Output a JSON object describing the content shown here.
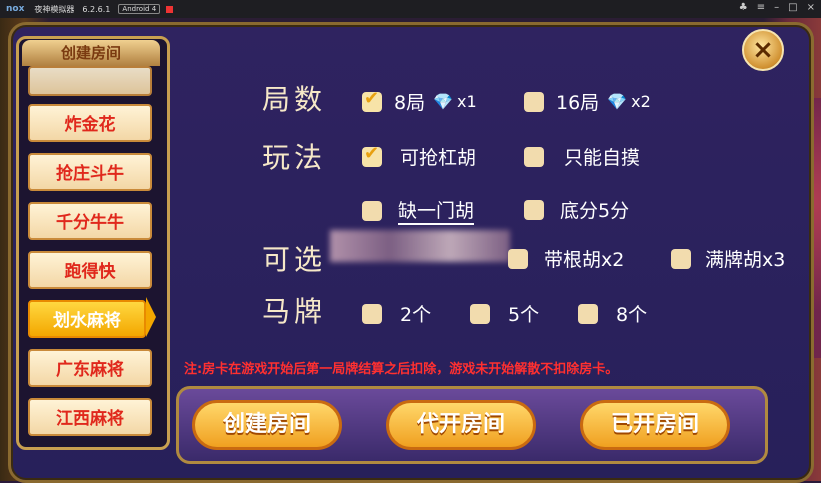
{
  "emulator": {
    "logo": "nox",
    "app_name": "夜神模拟器",
    "version": "6.2.6.1",
    "os": "Android 4"
  },
  "sidebar": {
    "title": "创建房间",
    "items": [
      {
        "label": "炸金花",
        "active": false
      },
      {
        "label": "抢庄斗牛",
        "active": false
      },
      {
        "label": "千分牛牛",
        "active": false
      },
      {
        "label": "跑得快",
        "active": false
      },
      {
        "label": "划水麻将",
        "active": true
      },
      {
        "label": "广东麻将",
        "active": false
      },
      {
        "label": "江西麻将",
        "active": false
      }
    ]
  },
  "close_icon": "×",
  "rounds": {
    "label": "局数",
    "options": [
      {
        "label": "8局",
        "multiplier": "x1",
        "checked": true
      },
      {
        "label": "16局",
        "multiplier": "x2",
        "checked": false
      }
    ]
  },
  "rules": {
    "label": "玩法",
    "options": [
      {
        "label": "可抢杠胡",
        "checked": true
      },
      {
        "label": "只能自摸",
        "checked": false
      },
      {
        "label": "缺一门胡",
        "checked": false
      },
      {
        "label": "底分5分",
        "checked": false
      }
    ]
  },
  "optional": {
    "label": "可选",
    "options": [
      {
        "label": "带根胡x2",
        "checked": false
      },
      {
        "label": "满牌胡x3",
        "checked": false
      }
    ]
  },
  "horses": {
    "label": "马牌",
    "options": [
      {
        "label": "2个",
        "checked": false
      },
      {
        "label": "5个",
        "checked": false
      },
      {
        "label": "8个",
        "checked": false
      }
    ]
  },
  "notice": "注:房卡在游戏开始后第一局牌结算之后扣除，游戏未开始解散不扣除房卡。",
  "buttons": {
    "create": "创建房间",
    "proxy": "代开房间",
    "opened": "已开房间"
  },
  "colors": {
    "panel": "#2f2360",
    "accent_gold": "#f0a020",
    "notice_red": "#ff3030",
    "menu_text_red": "#e0281c"
  }
}
